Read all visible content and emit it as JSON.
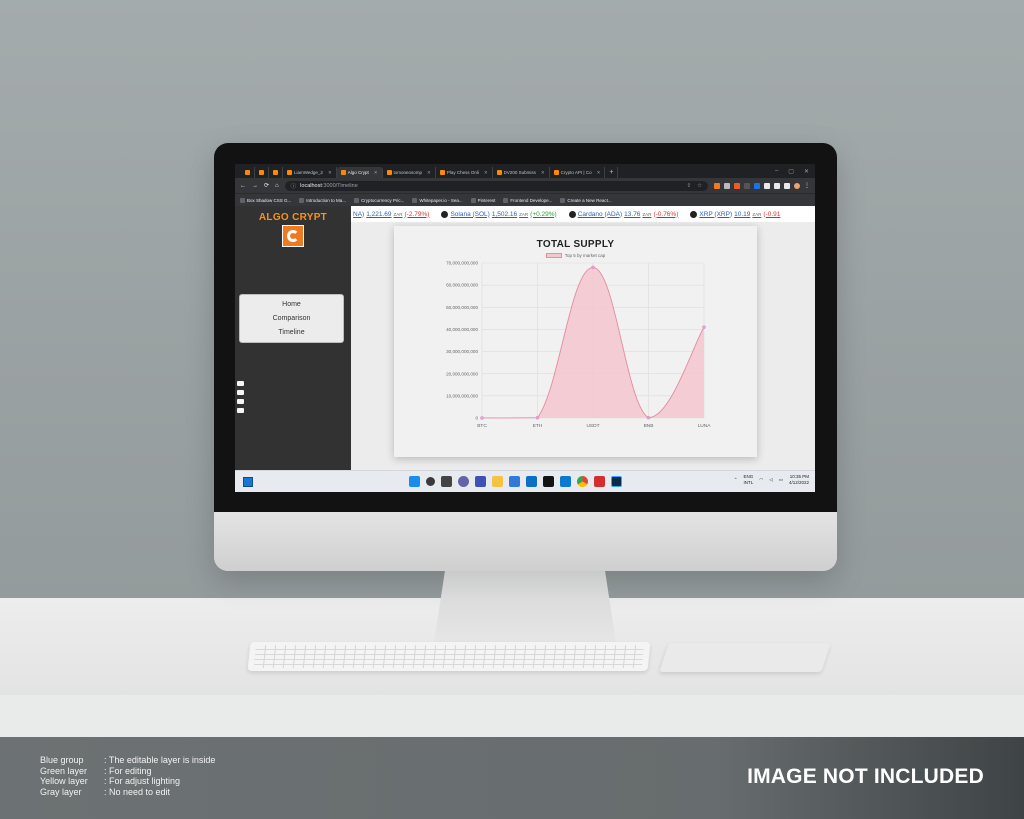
{
  "browser": {
    "tabs": [
      {
        "label": "",
        "icon": "gmail-icon"
      },
      {
        "label": "",
        "icon": "app-icon"
      },
      {
        "label": "",
        "icon": "github-icon"
      },
      {
        "label": "LiamWedge_2",
        "icon": "doc-icon"
      },
      {
        "label": "Algo Crypt",
        "icon": "algo-crypt-icon",
        "active": true
      },
      {
        "label": "tomoneosomp",
        "icon": "page-icon"
      },
      {
        "label": "Play Chess Onli",
        "icon": "chess-icon"
      },
      {
        "label": "DV200 Submiss",
        "icon": "drive-icon"
      },
      {
        "label": "Crypto API | Co",
        "icon": "api-icon"
      }
    ],
    "url_host": "localhost",
    "url_path": ":3000/Timeline",
    "bookmarks": [
      "Box Shadow CSS G...",
      "Introduction to Ma...",
      "Cryptocurrency Pric...",
      "Whitepaper.io - Sea...",
      "Pinterest",
      "Frontend Develope...",
      "Create a New React..."
    ]
  },
  "app": {
    "brand": "ALGO CRYPT",
    "nav": [
      "Home",
      "Comparison",
      "Timeline"
    ],
    "ticker": [
      {
        "name": "NA)",
        "price": "1,221.69",
        "currency": "ZAR",
        "change": "(-2.79%)",
        "dir": "dn",
        "icon": ""
      },
      {
        "name": "Solana (SOL)",
        "price": "1,502.16",
        "currency": "ZAR",
        "change": "(+0.29%)",
        "dir": "up",
        "icon": "solana-icon"
      },
      {
        "name": "Cardano (ADA)",
        "price": "13.76",
        "currency": "ZAR",
        "change": "(-0.76%)",
        "dir": "dn",
        "icon": "cardano-icon"
      },
      {
        "name": "XRP (XRP)",
        "price": "10.19",
        "currency": "ZAR",
        "change": "(-0.91",
        "dir": "dn",
        "icon": "xrp-icon"
      }
    ]
  },
  "chart_data": {
    "type": "area",
    "title": "TOTAL SUPPLY",
    "categories": [
      "BTC",
      "ETH",
      "USDT",
      "BNB",
      "LUNA"
    ],
    "series": [
      {
        "name": "Top 5 by market cap",
        "values": [
          19000000,
          120000000,
          68000000000,
          160000000,
          41000000000
        ]
      }
    ],
    "ylim": [
      0,
      70000000000
    ],
    "yticks": [
      "0",
      "10,000,000,000",
      "20,000,000,000",
      "30,000,000,000",
      "40,000,000,000",
      "50,000,000,000",
      "60,000,000,000",
      "70,000,000,000"
    ],
    "grid": true,
    "legend": "top-center",
    "colors": {
      "line": "#e58a9e",
      "fill": "#f4c7cf",
      "point": "#d6a4e8"
    }
  },
  "taskbar": {
    "lang": "ENG",
    "layout": "INTL",
    "time": "10:35 PM",
    "date": "4/12/2022"
  },
  "caption": {
    "legend": [
      {
        "key": "Blue group",
        "value": ": The editable layer is inside"
      },
      {
        "key": "Green layer",
        "value": ": For editing"
      },
      {
        "key": "Yellow layer",
        "value": ": For adjust lighting"
      },
      {
        "key": "Gray layer",
        "value": ": No need to edit"
      }
    ],
    "notice": "IMAGE NOT INCLUDED"
  }
}
